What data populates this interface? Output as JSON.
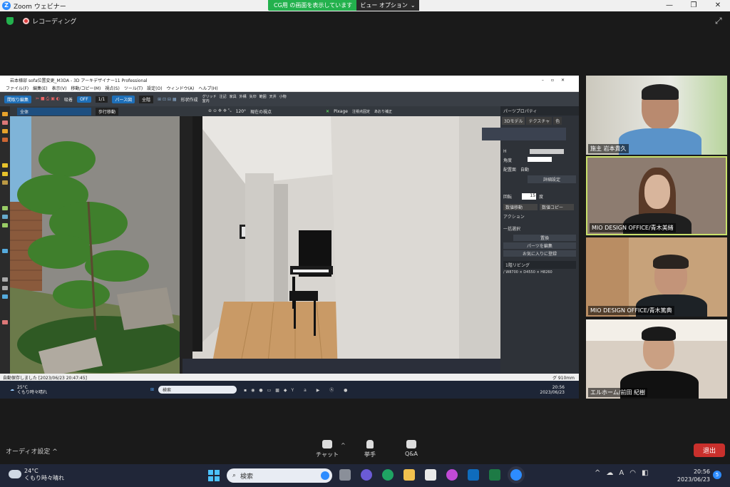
{
  "zoom": {
    "window_title": "Zoom ウェビナー",
    "share_banner": "CG用 の画面を表示しています",
    "view_options": "ビュー オプション",
    "recording_label": "レコーディング",
    "audio_settings": "オーディオ設定",
    "bottom_items": [
      {
        "label": "チャット",
        "icon": "chat-icon"
      },
      {
        "label": "挙手",
        "icon": "raise-hand-icon"
      },
      {
        "label": "Q&A",
        "icon": "qa-icon"
      }
    ],
    "leave_label": "退出"
  },
  "shared_app": {
    "title": "岩本様邸 sofa位置変更_M3DA - 3D アーキデザイナー11 Professional",
    "menu": [
      "ファイル(F)",
      "編集(E)",
      "表示(V)",
      "移動/コピー(M)",
      "視点(S)",
      "ツール(T)",
      "設定(O)",
      "ウィンドウ(A)",
      "ヘルプ(H)"
    ],
    "toolbar": {
      "back_btn": "間取り編集",
      "suction": "吸着",
      "off": "OFF",
      "scale": "1/1",
      "perspective": "パース図",
      "mode": "全階",
      "shape_create": "形状作成",
      "checks": [
        "グリッド",
        "注記",
        "家具",
        "外構",
        "矢印",
        "範囲",
        "天井",
        "小物",
        "室内"
      ]
    },
    "toolbar2": {
      "layer": "全体",
      "walk": "歩行移動",
      "angle": "120°",
      "view_point": "現在の視点",
      "pixage": "Pixage",
      "light_adj": "注視点固定",
      "auto_adj": "あおり補正",
      "camera_fix": "カメラ固定"
    },
    "side_panel": {
      "header": "パーツプロパティ",
      "tabs": [
        "3Dモデル",
        "テクスチャ",
        "色"
      ],
      "height_label": "H",
      "angle_label": "角度",
      "placement_label": "配置面",
      "auto_label": "自動",
      "detail_button": "詳細設定",
      "rotate_label": "回転",
      "rotate_value": "15",
      "rotate_unit": "度",
      "move_select": "数値移動",
      "copy_select": "数値コピー",
      "action_label": "アクション",
      "batch_label": "一括選択",
      "replace_button": "置換",
      "parts_edit": "パーツを編集",
      "favorites": "お気に入りに登録",
      "room_name": "1階リビング",
      "room_size": "/ W8700 × D4550 × H8260"
    },
    "status_left": "自動保存しました [2023/06/23 20:47:45]",
    "status_right": "グ 910mm",
    "inner_taskbar": {
      "temp": "25°C",
      "weather": "くもり時々晴れ",
      "search": "検索",
      "time": "20:56",
      "date": "2023/06/23"
    }
  },
  "participants": [
    {
      "name": "施主 岩本貴久",
      "active": false
    },
    {
      "name": "MIO DESIGN OFFICE/青木美緒",
      "active": true
    },
    {
      "name": "MIO DESIGN OFFICE/青木篤典",
      "active": false
    },
    {
      "name": "エルホーム/前田 紀樹",
      "active": false
    }
  ],
  "taskbar": {
    "temp": "24°C",
    "weather": "くもり時々晴れ",
    "search": "検索",
    "time": "20:56",
    "date": "2023/06/23",
    "notif_count": "5"
  },
  "colors": {
    "share_green": "#23b14d",
    "leave_red": "#c9302c",
    "active_speaker": "#c8e06a"
  }
}
